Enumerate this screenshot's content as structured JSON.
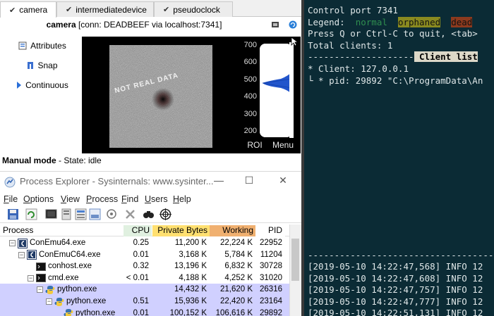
{
  "camera_app": {
    "tabs": [
      {
        "label": "camera",
        "active": true
      },
      {
        "label": "intermediatedevice",
        "active": false
      },
      {
        "label": "pseudoclock",
        "active": false
      }
    ],
    "title_bold": "camera",
    "title_rest": " [conn: DEADBEEF via localhost:7341]",
    "side_buttons": [
      {
        "label": "Attributes",
        "icon": "attributes-icon"
      },
      {
        "label": "Snap",
        "icon": "snap-icon"
      },
      {
        "label": "Continuous",
        "icon": "play-icon"
      }
    ],
    "watermark": "NOT REAL DATA",
    "histogram_ticks": [
      "700",
      "600",
      "500",
      "400",
      "300",
      "200"
    ],
    "roi_label": "ROI",
    "menu_label": "Menu",
    "status_bold": "Manual mode",
    "status_rest": " - State: idle"
  },
  "process_explorer": {
    "title": "Process Explorer - Sysinternals: www.sysinter...",
    "window_controls": [
      "—",
      "☐",
      "✕"
    ],
    "menu": [
      {
        "first": "F",
        "rest": "ile"
      },
      {
        "first": "O",
        "rest": "ptions"
      },
      {
        "first": "V",
        "rest": "iew"
      },
      {
        "first": "P",
        "rest": "rocess"
      },
      {
        "first": "F",
        "rest": "ind"
      },
      {
        "first": "U",
        "rest": "sers"
      },
      {
        "first": "H",
        "rest": "elp"
      }
    ],
    "columns": [
      "Process",
      "CPU",
      "Private Bytes",
      "Working Set",
      "PID"
    ],
    "rows": [
      {
        "name": "ConEmu64.exe",
        "cpu": "0.25",
        "private": "11,200 K",
        "working": "22,224 K",
        "pid": "22952",
        "indent": 0,
        "tree": "−",
        "icon": "conemu-icon",
        "bg": "#ffffff"
      },
      {
        "name": "ConEmuC64.exe",
        "cpu": "0.01",
        "private": "3,168 K",
        "working": "5,784 K",
        "pid": "11204",
        "indent": 1,
        "tree": "−",
        "icon": "conemu-icon",
        "bg": "#ffffff"
      },
      {
        "name": "conhost.exe",
        "cpu": "0.32",
        "private": "13,196 K",
        "working": "6,832 K",
        "pid": "30728",
        "indent": 2,
        "tree": "",
        "icon": "console-icon",
        "bg": "#ffffff"
      },
      {
        "name": "cmd.exe",
        "cpu": "< 0.01",
        "private": "4,188 K",
        "working": "4,252 K",
        "pid": "31020",
        "indent": 2,
        "tree": "−",
        "icon": "console-icon",
        "bg": "#ffffff"
      },
      {
        "name": "python.exe",
        "cpu": "",
        "private": "14,432 K",
        "working": "21,620 K",
        "pid": "26316",
        "indent": 3,
        "tree": "−",
        "icon": "python-icon",
        "bg": "#d0d0ff"
      },
      {
        "name": "python.exe",
        "cpu": "0.51",
        "private": "15,936 K",
        "working": "22,420 K",
        "pid": "23164",
        "indent": 4,
        "tree": "−",
        "icon": "python-icon",
        "bg": "#d0d0ff"
      },
      {
        "name": "python.exe",
        "cpu": "0.01",
        "private": "100,152 K",
        "working": "106,616 K",
        "pid": "29892",
        "indent": 5,
        "tree": "",
        "icon": "python-icon",
        "bg": "#d0d0ff"
      }
    ],
    "colors": {
      "cpu_head": "#e0f0e0",
      "private_head": "#ffe070",
      "working_head": "#f0b070",
      "pid_head": "#ffffff"
    }
  },
  "console": {
    "line_control_port": "Control port 7341",
    "legend_label": "Legend:  ",
    "legend_normal": "normal",
    "legend_orphaned": "orphaned",
    "legend_dead": "dead",
    "line_quit": "Press Q or Ctrl-C to quit, <tab>",
    "line_total": "Total clients: 1",
    "line_dashes": "--------------------",
    "client_list_label": " Client list",
    "line_client": "* Client: 127.0.0.1",
    "line_pid": "└ * pid: 29892 \"C:\\ProgramData\\An",
    "log_dashes": "--------------------------------------",
    "log_lines": [
      "[2019-05-10 14:22:47,568] INFO 12",
      "[2019-05-10 14:22:47,608] INFO 12",
      "[2019-05-10 14:22:47,757] INFO 12",
      "[2019-05-10 14:22:47,777] INFO 12",
      "[2019-05-10 14:22:51,131] INFO 12"
    ]
  }
}
